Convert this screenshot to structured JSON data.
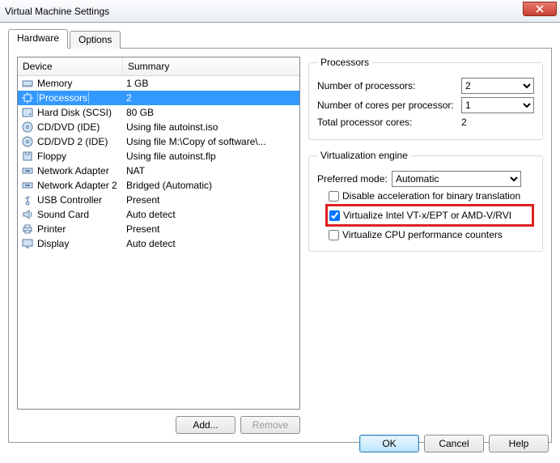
{
  "window": {
    "title": "Virtual Machine Settings"
  },
  "tabs": {
    "hardware": "Hardware",
    "options": "Options"
  },
  "headers": {
    "device": "Device",
    "summary": "Summary"
  },
  "devices": [
    {
      "name": "Memory",
      "summary": "1 GB",
      "icon": "memory-icon"
    },
    {
      "name": "Processors",
      "summary": "2",
      "icon": "cpu-icon",
      "selected": true
    },
    {
      "name": "Hard Disk (SCSI)",
      "summary": "80 GB",
      "icon": "hdd-icon"
    },
    {
      "name": "CD/DVD (IDE)",
      "summary": "Using file autoinst.iso",
      "icon": "cd-icon"
    },
    {
      "name": "CD/DVD 2 (IDE)",
      "summary": "Using file M:\\Copy of software\\...",
      "icon": "cd-icon"
    },
    {
      "name": "Floppy",
      "summary": "Using file autoinst.flp",
      "icon": "floppy-icon"
    },
    {
      "name": "Network Adapter",
      "summary": "NAT",
      "icon": "nic-icon"
    },
    {
      "name": "Network Adapter 2",
      "summary": "Bridged (Automatic)",
      "icon": "nic-icon"
    },
    {
      "name": "USB Controller",
      "summary": "Present",
      "icon": "usb-icon"
    },
    {
      "name": "Sound Card",
      "summary": "Auto detect",
      "icon": "sound-icon"
    },
    {
      "name": "Printer",
      "summary": "Present",
      "icon": "printer-icon"
    },
    {
      "name": "Display",
      "summary": "Auto detect",
      "icon": "display-icon"
    }
  ],
  "leftButtons": {
    "add": "Add...",
    "remove": "Remove"
  },
  "processors": {
    "legend": "Processors",
    "numProcessorsLabel": "Number of processors:",
    "numProcessors": "2",
    "coresPerProcLabel": "Number of cores per processor:",
    "coresPerProc": "1",
    "totalLabel": "Total processor cores:",
    "total": "2"
  },
  "virt": {
    "legend": "Virtualization engine",
    "preferredLabel": "Preferred mode:",
    "preferred": "Automatic",
    "chkDisable": "Disable acceleration for binary translation",
    "chkVT": "Virtualize Intel VT-x/EPT or AMD-V/RVI",
    "chkPerf": "Virtualize CPU performance counters"
  },
  "footer": {
    "ok": "OK",
    "cancel": "Cancel",
    "help": "Help"
  }
}
